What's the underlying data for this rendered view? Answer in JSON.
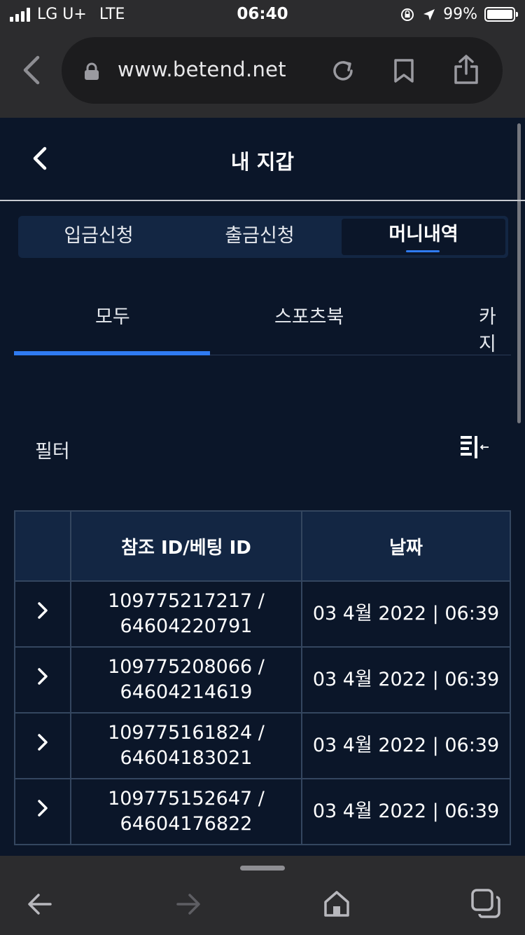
{
  "status_bar": {
    "carrier": "LG U+",
    "network": "LTE",
    "time": "06:40",
    "battery": "99%",
    "battery_level": 0.99
  },
  "browser": {
    "url": "www.betend.net",
    "icons": [
      "back-chevron-icon",
      "lock-icon",
      "reload-icon",
      "bookmark-icon",
      "share-icon",
      "back-arrow-icon",
      "forward-arrow-icon",
      "home-icon",
      "tabs-icon"
    ]
  },
  "header": {
    "title": "내 지갑"
  },
  "segments": [
    {
      "label": "입금신청",
      "active": false
    },
    {
      "label": "출금신청",
      "active": false
    },
    {
      "label": "머니내역",
      "active": true
    }
  ],
  "sub_tabs": [
    {
      "label": "모두",
      "active": true
    },
    {
      "label": "스포츠북",
      "active": false
    },
    {
      "label": "카지",
      "active": false
    }
  ],
  "filter": {
    "label": "필터"
  },
  "table": {
    "headers": [
      "",
      "참조 ID/베팅 ID",
      "날짜"
    ],
    "rows": [
      {
        "ref_line1": "109775217217 /",
        "ref_line2": "64604220791",
        "date": "03 4월 2022 | 06:39"
      },
      {
        "ref_line1": "109775208066 /",
        "ref_line2": "64604214619",
        "date": "03 4월 2022 | 06:39"
      },
      {
        "ref_line1": "109775161824 /",
        "ref_line2": "64604183021",
        "date": "03 4월 2022 | 06:39"
      },
      {
        "ref_line1": "109775152647 /",
        "ref_line2": "64604176822",
        "date": "03 4월 2022 | 06:39"
      }
    ]
  },
  "colors": {
    "page_bg": "#0b1629",
    "panel_bg": "#132643",
    "accent": "#2f7bf2",
    "browser_chrome": "#2c2c2e"
  }
}
